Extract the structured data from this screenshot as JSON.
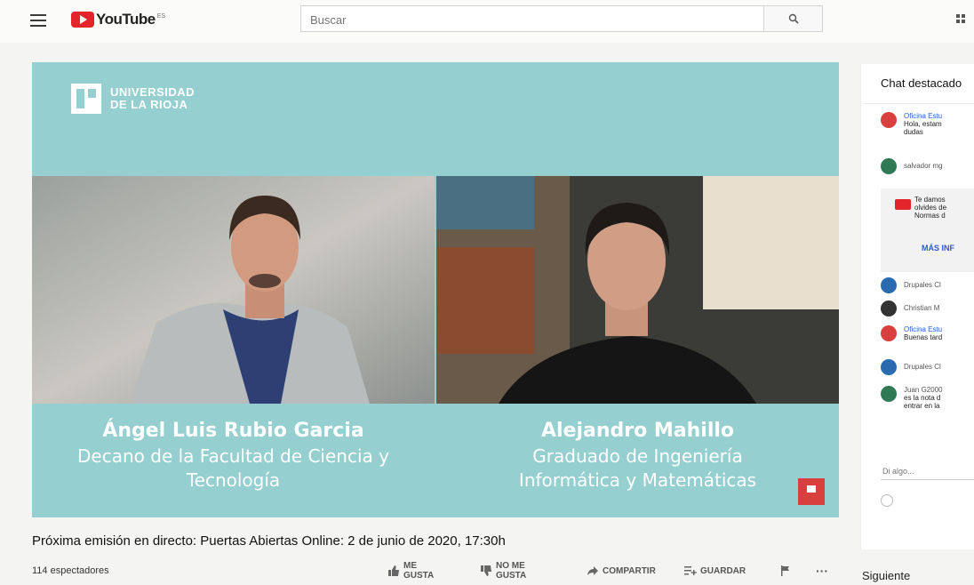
{
  "header": {
    "logo_text": "YouTube",
    "logo_region": "ES",
    "search_placeholder": "Buscar"
  },
  "video": {
    "university_line1": "UNIVERSIDAD",
    "university_line2": "DE LA RIOJA",
    "speaker_left": {
      "name": "Ángel Luis Rubio Garcia",
      "role_line1": "Decano de la Facultad de Ciencia y",
      "role_line2": "Tecnología"
    },
    "speaker_right": {
      "name": "Alejandro Mahillo",
      "role_line1": "Graduado de Ingeniería",
      "role_line2": "Informática y Matemáticas"
    },
    "skype_badge": "S"
  },
  "info": {
    "title": "Próxima emisión en directo: Puertas Abiertas Online: 2 de junio de 2020, 17:30h",
    "viewers": "114 espectadores"
  },
  "actions": {
    "like_line1": "ME",
    "like_line2": "GUSTA",
    "dislike_line1": "NO ME",
    "dislike_line2": "GUSTA",
    "share": "COMPARTIR",
    "save": "GUARDAR",
    "more": "···"
  },
  "chat": {
    "title": "Chat destacado",
    "messages": [
      {
        "author": "Oficina Estu",
        "text1": "Hola, estam",
        "text2": "dudas",
        "avatar_color": "#d8403e"
      },
      {
        "author": "salvador mg",
        "avatar_color": "#2f7a55"
      },
      {
        "author": "Drupales Cl",
        "avatar_color": "#2a6bb0"
      },
      {
        "author": "Christian M",
        "avatar_color": "#333333"
      },
      {
        "author": "Oficina Estu",
        "text1": "Buenas tard",
        "avatar_color": "#d8403e"
      },
      {
        "author": "Drupales Cl",
        "avatar_color": "#2a6bb0"
      },
      {
        "author": "Juan G2000",
        "text1": "es la nota d",
        "text2": "entrar en la",
        "avatar_color": "#2f7a55"
      }
    ],
    "notice_line1": "Te damos",
    "notice_line2": "olvides de",
    "notice_line3": "Normas d",
    "more_info": "MÁS INF",
    "input_placeholder": "Di algo..."
  },
  "sidebar": {
    "next_label": "Siguiente"
  }
}
